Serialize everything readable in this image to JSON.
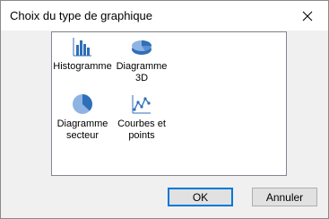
{
  "window": {
    "title": "Choix du type de graphique",
    "close_symbol": "✕"
  },
  "chart_types": [
    {
      "label": "Histogramme",
      "icon": "histogram-icon"
    },
    {
      "label": "Diagramme\n3D",
      "icon": "pie-3d-icon"
    },
    {
      "label": "Diagramme\nsecteur",
      "icon": "pie-chart-icon"
    },
    {
      "label": "Courbes et\npoints",
      "icon": "line-points-icon"
    }
  ],
  "buttons": {
    "ok_label": "OK",
    "cancel_label": "Annuler"
  },
  "colors": {
    "icon_blue": "#2f6fb7",
    "icon_light_blue": "#8fb4e3",
    "focus_border": "#0078d7"
  }
}
